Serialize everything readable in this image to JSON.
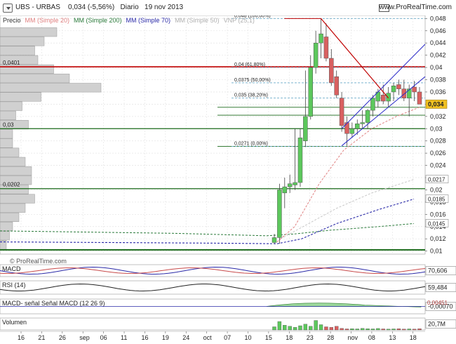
{
  "header": {
    "title": "UBS - URBAS",
    "price": "0,034",
    "change": "(-5,56%)",
    "period": "Diario",
    "date": "19 nov 2013",
    "brand": "www.ProRealTime.com"
  },
  "legend": {
    "precio": "Precio",
    "mm20": "MM (Simple 20)",
    "mm200": "MM (Simple 200)",
    "mm70": "MM (Simple 70)",
    "mm50": "MM (Simple 50)",
    "vnp": "VNP (25,1)",
    "watermark": "© ProRealTime.com"
  },
  "colors": {
    "up": "#5cc85c",
    "down": "#d96060",
    "mm20": "#e08080",
    "mm200": "#2a7a3a",
    "mm70": "#2a2aa8",
    "mm50": "#c8c8c8",
    "resistance": "#c00000",
    "support": "#1a6a1a",
    "fib": "#6aaac8",
    "channel": "#2a2ac8",
    "price_badge": "#f0c020"
  },
  "chart_data": [
    {
      "type": "candlestick",
      "title": "UBS - URBAS",
      "ylim": [
        0.0095,
        0.0485
      ],
      "x_ticks": [
        "16",
        "21",
        "26",
        "sep",
        "06",
        "11",
        "16",
        "19",
        "24",
        "oct",
        "07",
        "10",
        "15",
        "18",
        "23",
        "28",
        "nov",
        "08",
        "13",
        "18"
      ],
      "y_ticks": [
        "0,048",
        "0,046",
        "0,044",
        "0,042",
        "0,04",
        "0,038",
        "0,036",
        "0,034",
        "0,032",
        "0,03",
        "0,028",
        "0,026",
        "0,024",
        "0,022",
        "0,02",
        "0,018",
        "0,016",
        "0,014",
        "0,012",
        "0,01"
      ],
      "last_price": "0,034",
      "candles": [
        {
          "o": 0.0114,
          "h": 0.0128,
          "l": 0.0112,
          "c": 0.0122
        },
        {
          "o": 0.0122,
          "h": 0.021,
          "l": 0.0112,
          "c": 0.02
        },
        {
          "o": 0.0195,
          "h": 0.022,
          "l": 0.017,
          "c": 0.0205
        },
        {
          "o": 0.0205,
          "h": 0.0225,
          "l": 0.0195,
          "c": 0.021
        },
        {
          "o": 0.0208,
          "h": 0.03,
          "l": 0.02,
          "c": 0.0212
        },
        {
          "o": 0.0212,
          "h": 0.03,
          "l": 0.0205,
          "c": 0.0285
        },
        {
          "o": 0.028,
          "h": 0.0395,
          "l": 0.027,
          "c": 0.032
        },
        {
          "o": 0.032,
          "h": 0.042,
          "l": 0.0315,
          "c": 0.04
        },
        {
          "o": 0.04,
          "h": 0.046,
          "l": 0.039,
          "c": 0.044
        },
        {
          "o": 0.044,
          "h": 0.048,
          "l": 0.0415,
          "c": 0.0455
        },
        {
          "o": 0.045,
          "h": 0.0472,
          "l": 0.041,
          "c": 0.0415
        },
        {
          "o": 0.0415,
          "h": 0.043,
          "l": 0.037,
          "c": 0.0375
        },
        {
          "o": 0.0385,
          "h": 0.0395,
          "l": 0.035,
          "c": 0.0355
        },
        {
          "o": 0.035,
          "h": 0.036,
          "l": 0.0295,
          "c": 0.0305
        },
        {
          "o": 0.031,
          "h": 0.032,
          "l": 0.0272,
          "c": 0.0292
        },
        {
          "o": 0.0292,
          "h": 0.031,
          "l": 0.0285,
          "c": 0.03
        },
        {
          "o": 0.03,
          "h": 0.0315,
          "l": 0.029,
          "c": 0.0308
        },
        {
          "o": 0.0308,
          "h": 0.033,
          "l": 0.03,
          "c": 0.031
        },
        {
          "o": 0.031,
          "h": 0.0332,
          "l": 0.03,
          "c": 0.033
        },
        {
          "o": 0.033,
          "h": 0.0355,
          "l": 0.032,
          "c": 0.035
        },
        {
          "o": 0.0345,
          "h": 0.0365,
          "l": 0.0335,
          "c": 0.036
        },
        {
          "o": 0.0355,
          "h": 0.0372,
          "l": 0.034,
          "c": 0.0345
        },
        {
          "o": 0.0345,
          "h": 0.0368,
          "l": 0.0335,
          "c": 0.0358
        },
        {
          "o": 0.036,
          "h": 0.0375,
          "l": 0.0345,
          "c": 0.037
        },
        {
          "o": 0.0372,
          "h": 0.038,
          "l": 0.0355,
          "c": 0.0365
        },
        {
          "o": 0.0365,
          "h": 0.038,
          "l": 0.0345,
          "c": 0.035
        },
        {
          "o": 0.035,
          "h": 0.0372,
          "l": 0.032,
          "c": 0.0365
        },
        {
          "o": 0.0368,
          "h": 0.0378,
          "l": 0.0345,
          "c": 0.036
        },
        {
          "o": 0.036,
          "h": 0.0368,
          "l": 0.034,
          "c": 0.034
        }
      ],
      "fib_levels": [
        {
          "label": "0,048 (100,00%)",
          "value": 0.048
        },
        {
          "label": "0,04 (61,80%)",
          "value": 0.04
        },
        {
          "label": "0,0375 (50,00%)",
          "value": 0.0375
        },
        {
          "label": "0,035 (38,20%)",
          "value": 0.035
        },
        {
          "label": "0,0271 (0,00%)",
          "value": 0.0271
        }
      ],
      "resistance_level": {
        "label": "0,0401",
        "value": 0.0401
      },
      "support_levels": [
        {
          "label": "0,03",
          "value": 0.03
        },
        {
          "label": "0,0202",
          "value": 0.0202
        }
      ],
      "ma_badges": [
        {
          "label": "0,0217",
          "value": 0.0217
        },
        {
          "label": "0,0185",
          "value": 0.0185
        },
        {
          "label": "0,0145",
          "value": 0.0145
        }
      ],
      "volume_profile": [
        0.18,
        0.14,
        0.11,
        0.12,
        0.17,
        0.22,
        0.32,
        0.13,
        0.07,
        0.05,
        0.09,
        0.04,
        0.04,
        0.06,
        0.08,
        0.1,
        0.1,
        0.09,
        0.11,
        0.08,
        0.06,
        0.04,
        0.03,
        0.02
      ]
    },
    {
      "type": "line",
      "title": "MACD",
      "ylabel_right": "70,606"
    },
    {
      "type": "line",
      "title": "RSI (14)",
      "ylabel_right": "59,484"
    },
    {
      "type": "area",
      "title": "MACD- señal Señal MACD (12 26 9)",
      "ylabel_right": "-0,00070",
      "extra_label": "0,00451"
    },
    {
      "type": "bar",
      "title": "Volumen",
      "ylabel_right": "20,7M",
      "bars": [
        0.3,
        0.8,
        0.45,
        0.35,
        0.25,
        0.4,
        0.55,
        0.35,
        0.9,
        0.5,
        0.3,
        0.25,
        0.35,
        0.15,
        0.1,
        0.12,
        0.1,
        0.15,
        0.12,
        0.1,
        0.14,
        0.1,
        0.08,
        0.1,
        0.12,
        0.08,
        0.1,
        0.08,
        0.12
      ]
    }
  ]
}
